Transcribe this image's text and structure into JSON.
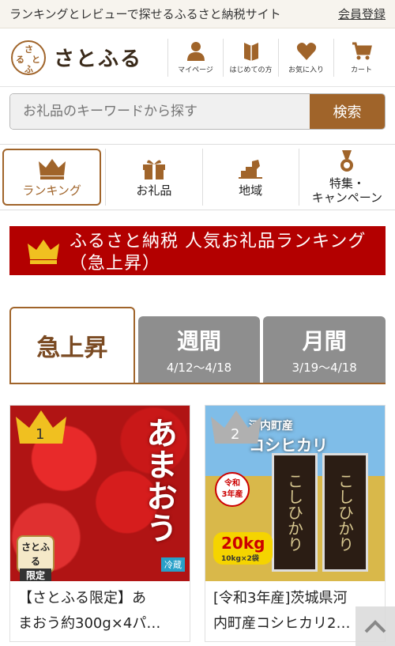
{
  "topbar": {
    "tagline": "ランキングとレビューで探せるふるさと納税サイト",
    "register": "会員登録"
  },
  "logo": {
    "text": "さとふる",
    "mark_chars": [
      "さ",
      "と",
      "ふ",
      "る"
    ]
  },
  "header_nav": [
    {
      "label": "マイページ",
      "icon": "person-icon"
    },
    {
      "label": "はじめての方",
      "icon": "book-icon"
    },
    {
      "label": "お気に入り",
      "icon": "heart-icon"
    },
    {
      "label": "カート",
      "icon": "cart-icon"
    }
  ],
  "search": {
    "placeholder": "お礼品のキーワードから探す",
    "button": "検索"
  },
  "categories": [
    {
      "label": "ランキング",
      "icon": "crown-icon",
      "active": true
    },
    {
      "label": "お礼品",
      "icon": "gift-icon",
      "active": false
    },
    {
      "label": "地域",
      "icon": "map-icon",
      "active": false
    },
    {
      "label": "特集・\nキャンペーン",
      "line1": "特集・",
      "line2": "キャンペーン",
      "icon": "medal-icon",
      "active": false
    }
  ],
  "banner": {
    "title": "ふるさと納税 人気お礼品ランキング（急上昇）"
  },
  "tabs": [
    {
      "label": "急上昇",
      "range": "",
      "active": true
    },
    {
      "label": "週間",
      "range": "4/12〜4/18",
      "active": false
    },
    {
      "label": "月間",
      "range": "3/19〜4/18",
      "active": false
    }
  ],
  "items": [
    {
      "rank": "1",
      "title_line1": "【さとふる限定】あ",
      "title_line2": "まおう約300g×4パ…",
      "image_text": "あまおう",
      "badge": "さとふる\n限定",
      "badge_line1": "さとふる",
      "badge_line2": "限定",
      "cold": "冷蔵"
    },
    {
      "rank": "2",
      "title_line1": "[令和3年産]茨城県河",
      "title_line2": "内町産コシヒカリ2…",
      "image_title_line1": "河内町産",
      "image_title_line2": "コシヒカリ",
      "tag_line1": "令和",
      "tag_line2": "3年産",
      "kg": "20kg",
      "kg_sub": "10kg×2袋",
      "bag_text": "こしひかり"
    }
  ],
  "colors": {
    "brand": "#a0642a",
    "banner": "#b30000",
    "tab_inactive": "#8e8e8e",
    "crown_gold": "#f0c020",
    "crown_silver": "#b0b0b0"
  }
}
